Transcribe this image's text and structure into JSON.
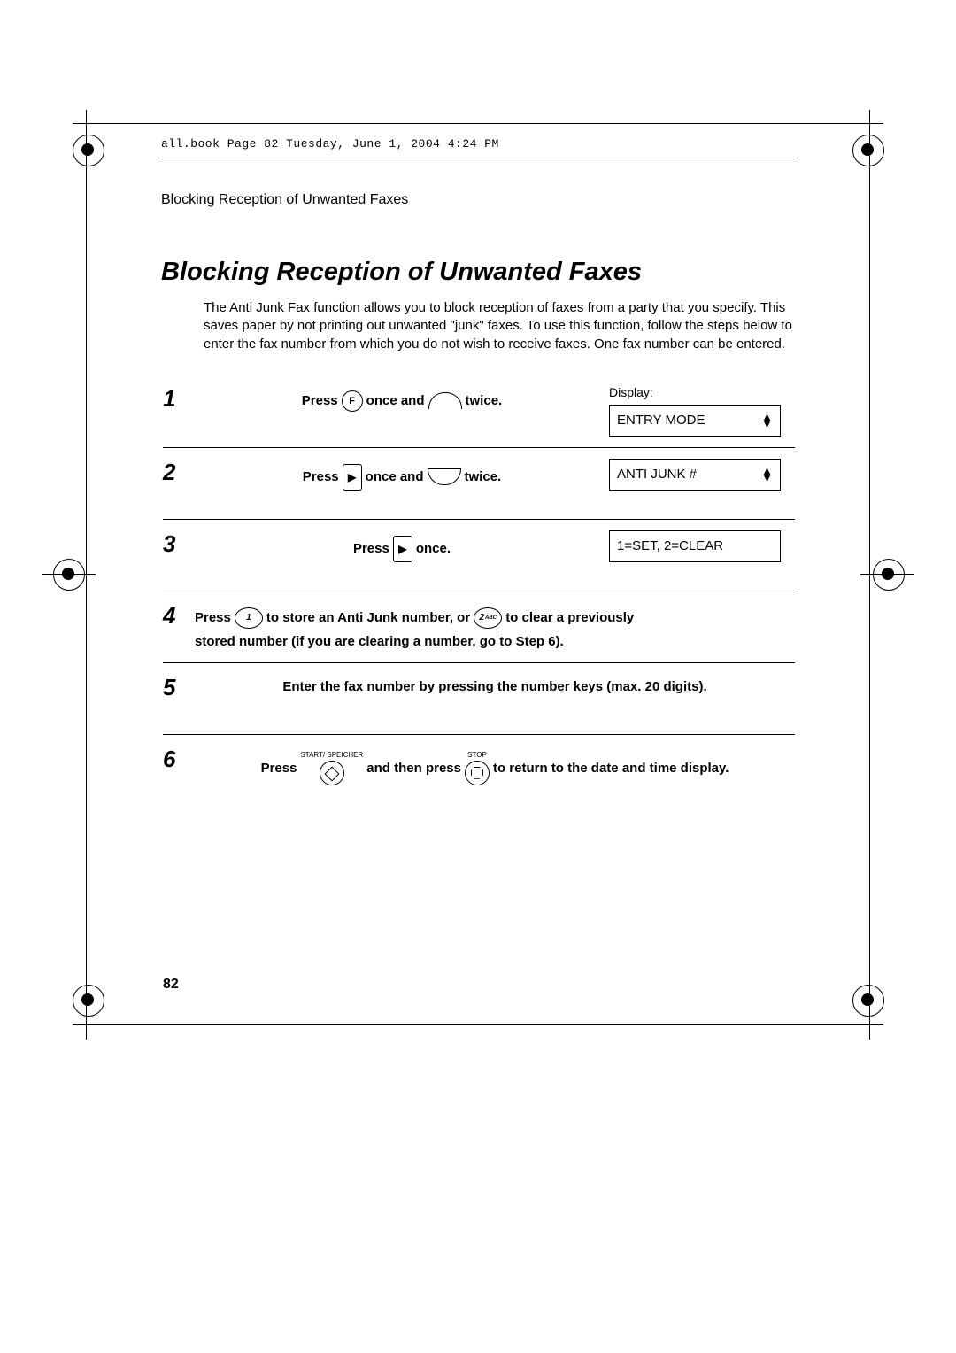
{
  "meta": {
    "bookline": "all.book  Page 82  Tuesday, June 1, 2004  4:24 PM"
  },
  "header": {
    "running": "Blocking Reception of Unwanted Faxes",
    "title": "Blocking Reception of Unwanted Faxes"
  },
  "intro": "The Anti Junk Fax function allows you to block reception of faxes from a party that you specify. This saves paper by not printing out unwanted \"junk\" faxes. To use this function, follow the steps below to enter the fax number from which you do not wish to receive faxes. One fax number can be entered.",
  "display_label": "Display:",
  "steps": {
    "s1": {
      "num": "1",
      "t1": "Press",
      "btnF": "F",
      "t2": "once and",
      "t3": "twice.",
      "lcd": "ENTRY MODE"
    },
    "s2": {
      "num": "2",
      "t1": "Press",
      "t2": "once and",
      "t3": "twice.",
      "lcd": "ANTI JUNK #"
    },
    "s3": {
      "num": "3",
      "t1": "Press",
      "t2": "once.",
      "lcd": "1=SET, 2=CLEAR"
    },
    "s4": {
      "num": "4",
      "t1": "Press",
      "btn1": "1",
      "t2": "to store an Anti Junk number, or",
      "btn2": "2",
      "btn2sub": "ABC",
      "t3": "to clear a previously",
      "line2": "stored number (if you are clearing a number, go to Step 6)."
    },
    "s5": {
      "num": "5",
      "text": "Enter the fax number by pressing the number keys (max. 20 digits)."
    },
    "s6": {
      "num": "6",
      "t1": "Press",
      "start_lbl": "START/\nSPEICHER",
      "t2": "and then press",
      "stop_lbl": "STOP",
      "t3": "to return to the date and time display."
    }
  },
  "page_number": "82"
}
